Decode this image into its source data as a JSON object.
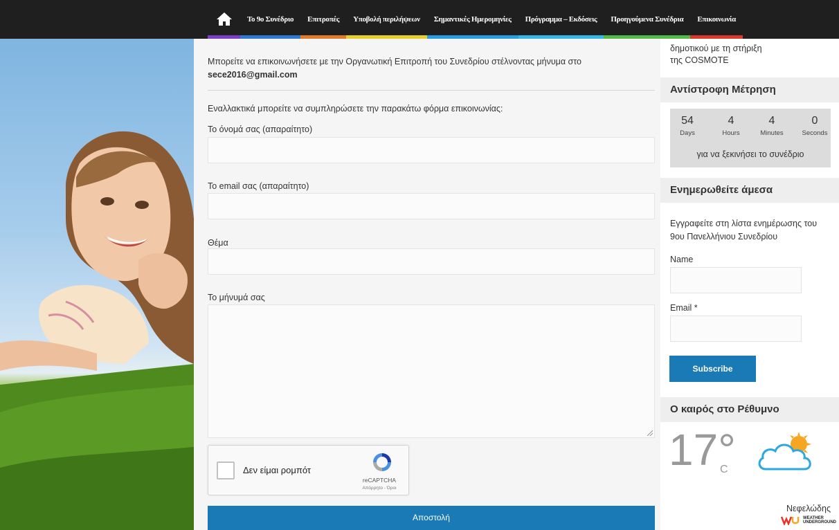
{
  "nav": {
    "items": [
      {
        "label": "Το 9ο Συνέδριο",
        "color": "#2e7bcf"
      },
      {
        "label": "Επιτροπές",
        "color": "#e07b2a"
      },
      {
        "label": "Υποβολή περιλήψεων",
        "color": "#e8cf2b"
      },
      {
        "label": "Σημαντικές Ημερομηνίες",
        "color": "#2a9de0"
      },
      {
        "label": "Πρόγραμμα – Εκδόσεις",
        "color": "#34b7e4"
      },
      {
        "label": "Προηγούμενα Συνέδρια",
        "color": "#55b948"
      },
      {
        "label": "Επικοινωνία",
        "color": "#d83a2e"
      }
    ],
    "home_color": "#7b3fc4"
  },
  "main": {
    "intro": "Μπορείτε να επικοινωνήσετε με την Οργανωτική Επιτροπή του Συνεδρίου στέλνοντας μήνυμα στο",
    "email": "sece2016@gmail.com",
    "alt_text": "Εναλλακτικά μπορείτε να συμπληρώσετε την παρακάτω φόρμα επικοινωνίας:",
    "name_label": "Το όνομά σας (απαραίτητο)",
    "email_label": "Το email σας (απαραίτητο)",
    "subject_label": "Θέμα",
    "message_label": "Το μήνυμά σας",
    "submit_label": "Αποστολή"
  },
  "captcha": {
    "text": "Δεν είμαι ρομπότ",
    "brand": "reCAPTCHA",
    "terms": "Απόρρητο - Όροι"
  },
  "sidebar": {
    "top_text_1": "δημοτικού με τη στήριξη",
    "top_text_2": "της COSMOTE",
    "countdown_title": "Αντίστροφη Μέτρηση",
    "countdown": {
      "days": "54",
      "days_label": "Days",
      "hours": "4",
      "hours_label": "Hours",
      "minutes": "4",
      "minutes_label": "Minutes",
      "seconds": "0",
      "seconds_label": "Seconds",
      "caption": "για να ξεκινήσει το συνέδριο"
    },
    "newsletter_title": "Ενημερωθείτε άμεσα",
    "newsletter_text_1": "Εγγραφείτε στη λίστα ενημέρωσης του",
    "newsletter_text_2": "9ου Πανελλήνιου Συνεδρίου",
    "name_label": "Name",
    "email_label": "Email *",
    "subscribe_label": "Subscribe",
    "weather_title": "Ο καιρός στο Ρέθυμνο",
    "temperature": "17°",
    "temp_unit": "C",
    "condition": "Νεφελώδης",
    "wu_text_1": "WEATHER",
    "wu_text_2": "UNDERGROUND"
  }
}
